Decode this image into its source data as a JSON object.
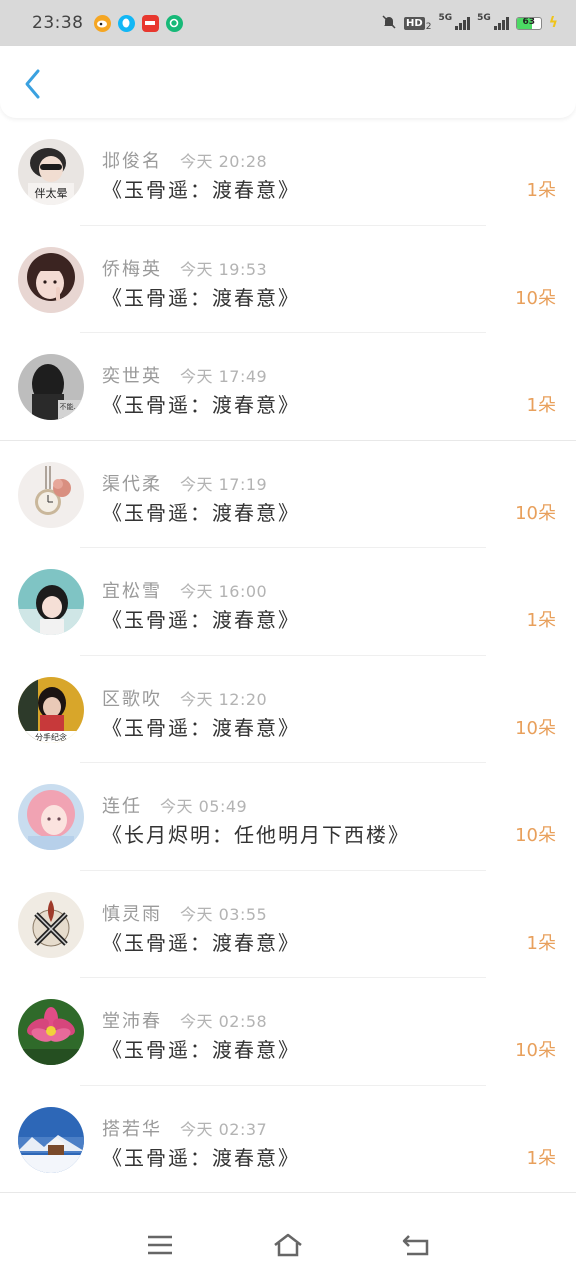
{
  "status": {
    "time": "23:38",
    "network_1": "5G",
    "network_2": "5G",
    "hd": "HD",
    "hd_sub": "2",
    "battery": "63",
    "battery_fraction": 0.63,
    "app_icons": [
      "weibo-icon",
      "qq-icon",
      "red-app-icon",
      "green-app-icon"
    ]
  },
  "colors": {
    "accent": "#3aa1e0",
    "count": "#e8a05c",
    "name": "#9a9a9a",
    "timestamp": "#b3b3b3"
  },
  "items": [
    {
      "name": "邶俊名",
      "time": "今天 20:28",
      "book": "《玉骨遥：渡春意》",
      "count": "1朵"
    },
    {
      "name": "侨梅英",
      "time": "今天 19:53",
      "book": "《玉骨遥：渡春意》",
      "count": "10朵"
    },
    {
      "name": "奕世英",
      "time": "今天 17:49",
      "book": "《玉骨遥：渡春意》",
      "count": "1朵"
    },
    {
      "name": "渠代柔",
      "time": "今天 17:19",
      "book": "《玉骨遥：渡春意》",
      "count": "10朵"
    },
    {
      "name": "宜松雪",
      "time": "今天 16:00",
      "book": "《玉骨遥：渡春意》",
      "count": "1朵"
    },
    {
      "name": "区歌吹",
      "time": "今天 12:20",
      "book": "《玉骨遥：渡春意》",
      "count": "10朵"
    },
    {
      "name": "连任",
      "time": "今天 05:49",
      "book": "《长月烬明：任他明月下西楼》",
      "count": "10朵"
    },
    {
      "name": "慎灵雨",
      "time": "今天 03:55",
      "book": "《玉骨遥：渡春意》",
      "count": "1朵"
    },
    {
      "name": "堂沛春",
      "time": "今天 02:58",
      "book": "《玉骨遥：渡春意》",
      "count": "10朵"
    },
    {
      "name": "搭若华",
      "time": "今天 02:37",
      "book": "《玉骨遥：渡春意》",
      "count": "1朵"
    }
  ],
  "avatar_text": {
    "first": "伴太晕",
    "third": "不能…",
    "sixth": "分手纪念"
  },
  "nav": [
    "menu-icon",
    "home-icon",
    "back-nav-icon"
  ]
}
